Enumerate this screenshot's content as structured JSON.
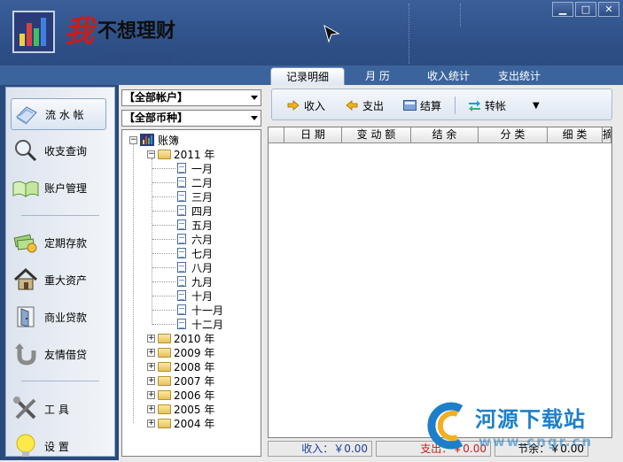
{
  "app": {
    "title_char1": "我",
    "title_rest": "不想理财",
    "window_controls": {
      "minimize": "▁",
      "maximize": "□",
      "close": "✕"
    }
  },
  "tabs": [
    {
      "label": "记录明细",
      "active": true
    },
    {
      "label": "月  历",
      "active": false
    },
    {
      "label": "收入统计",
      "active": false
    },
    {
      "label": "支出统计",
      "active": false
    }
  ],
  "sidebar": {
    "items": [
      {
        "label": "流 水 帐",
        "icon": "ledger-book-icon",
        "active": true
      },
      {
        "label": "收支查询",
        "icon": "magnifier-icon"
      },
      {
        "label": "账户管理",
        "icon": "open-book-icon"
      },
      {
        "label": "定期存款",
        "icon": "money-stack-icon"
      },
      {
        "label": "重大资产",
        "icon": "house-icon"
      },
      {
        "label": "商业贷款",
        "icon": "door-icon"
      },
      {
        "label": "友情借贷",
        "icon": "return-arrow-icon"
      },
      {
        "label": "工     具",
        "icon": "tools-icon"
      },
      {
        "label": "设     置",
        "icon": "lightbulb-icon"
      }
    ]
  },
  "filters": {
    "account": "【全部帐户】",
    "currency": "【全部币种】"
  },
  "tree": {
    "root": "账簿",
    "expanded_year": "2011 年",
    "months": [
      "一月",
      "二月",
      "三月",
      "四月",
      "五月",
      "六月",
      "七月",
      "八月",
      "九月",
      "十月",
      "十一月",
      "十二月"
    ],
    "other_years": [
      "2010 年",
      "2009 年",
      "2008 年",
      "2007 年",
      "2006 年",
      "2005 年",
      "2004 年"
    ]
  },
  "toolbar": {
    "income": "收入",
    "expense": "支出",
    "settle": "结算",
    "transfer": "转帐",
    "more": "▼"
  },
  "grid": {
    "columns": [
      "日  期",
      "变 动 额",
      "结  余",
      "分  类",
      "细  类",
      "摘"
    ]
  },
  "status": {
    "income": "收入：￥0.00",
    "expense": "支出：￥0.00",
    "savings": "节余：￥0.00"
  },
  "watermark": {
    "text": "河源下载站",
    "url": "www.cngr.cn"
  },
  "colors": {
    "header_bg": "#2d4f86",
    "title_red": "#c81d1d",
    "expense_red": "#c81d1d",
    "income_blue": "#1a3f9a",
    "watermark_blue": "#1d7fc9"
  }
}
